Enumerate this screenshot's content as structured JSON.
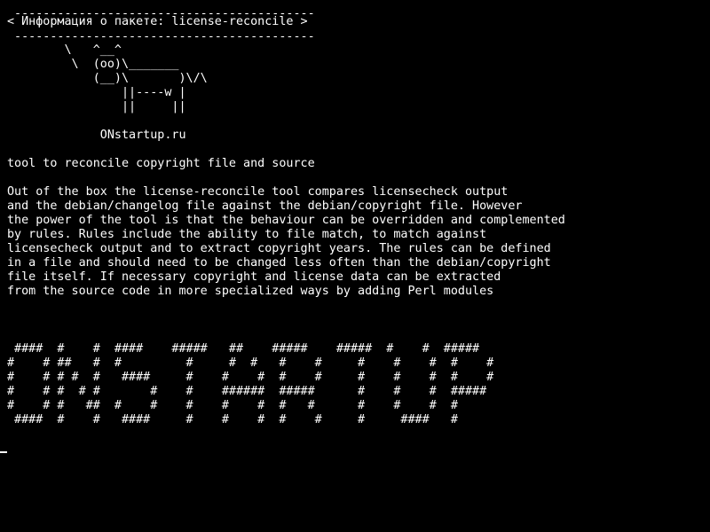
{
  "terminal": {
    "colors": {
      "background": "#000000",
      "foreground": "#ffffff"
    },
    "lines": [
      " ------------------------------------------",
      "< Информация о пакете: license-reconcile >",
      " ------------------------------------------",
      "        \\   ^__^",
      "         \\  (oo)\\_______",
      "            (__)\\       )\\/\\",
      "                ||----w |",
      "                ||     ||",
      "",
      "             ONstartup.ru",
      "",
      "tool to reconcile copyright file and source",
      "",
      "Out of the box the license-reconcile tool compares licensecheck output",
      "and the debian/changelog file against the debian/copyright file. However",
      "the power of the tool is that the behaviour can be overridden and complemented",
      "by rules. Rules include the ability to file match, to match against",
      "licensecheck output and to extract copyright years. The rules can be defined",
      "in a file and should need to be changed less often than the debian/copyright",
      "file itself. If necessary copyright and license data can be extracted",
      "from the source code in more specialized ways by adding Perl modules",
      "",
      "",
      "",
      " ####  #    #  ####    #####   ##    #####    #####  #    #  #####",
      "#    # ##   #  #         #     #  #   #    #     #    #    #  #    #",
      "#    # # #  #   ####     #    #    #  #    #     #    #    #  #    #",
      "#    # #  # #       #    #    ######  #####      #    #    #  #####",
      "#    # #   ##  #    #    #    #    #  #   #      #    #    #  #",
      " ####  #    #   ####     #    #    #  #    #     #     ####   #"
    ],
    "cursor_char": "_"
  }
}
